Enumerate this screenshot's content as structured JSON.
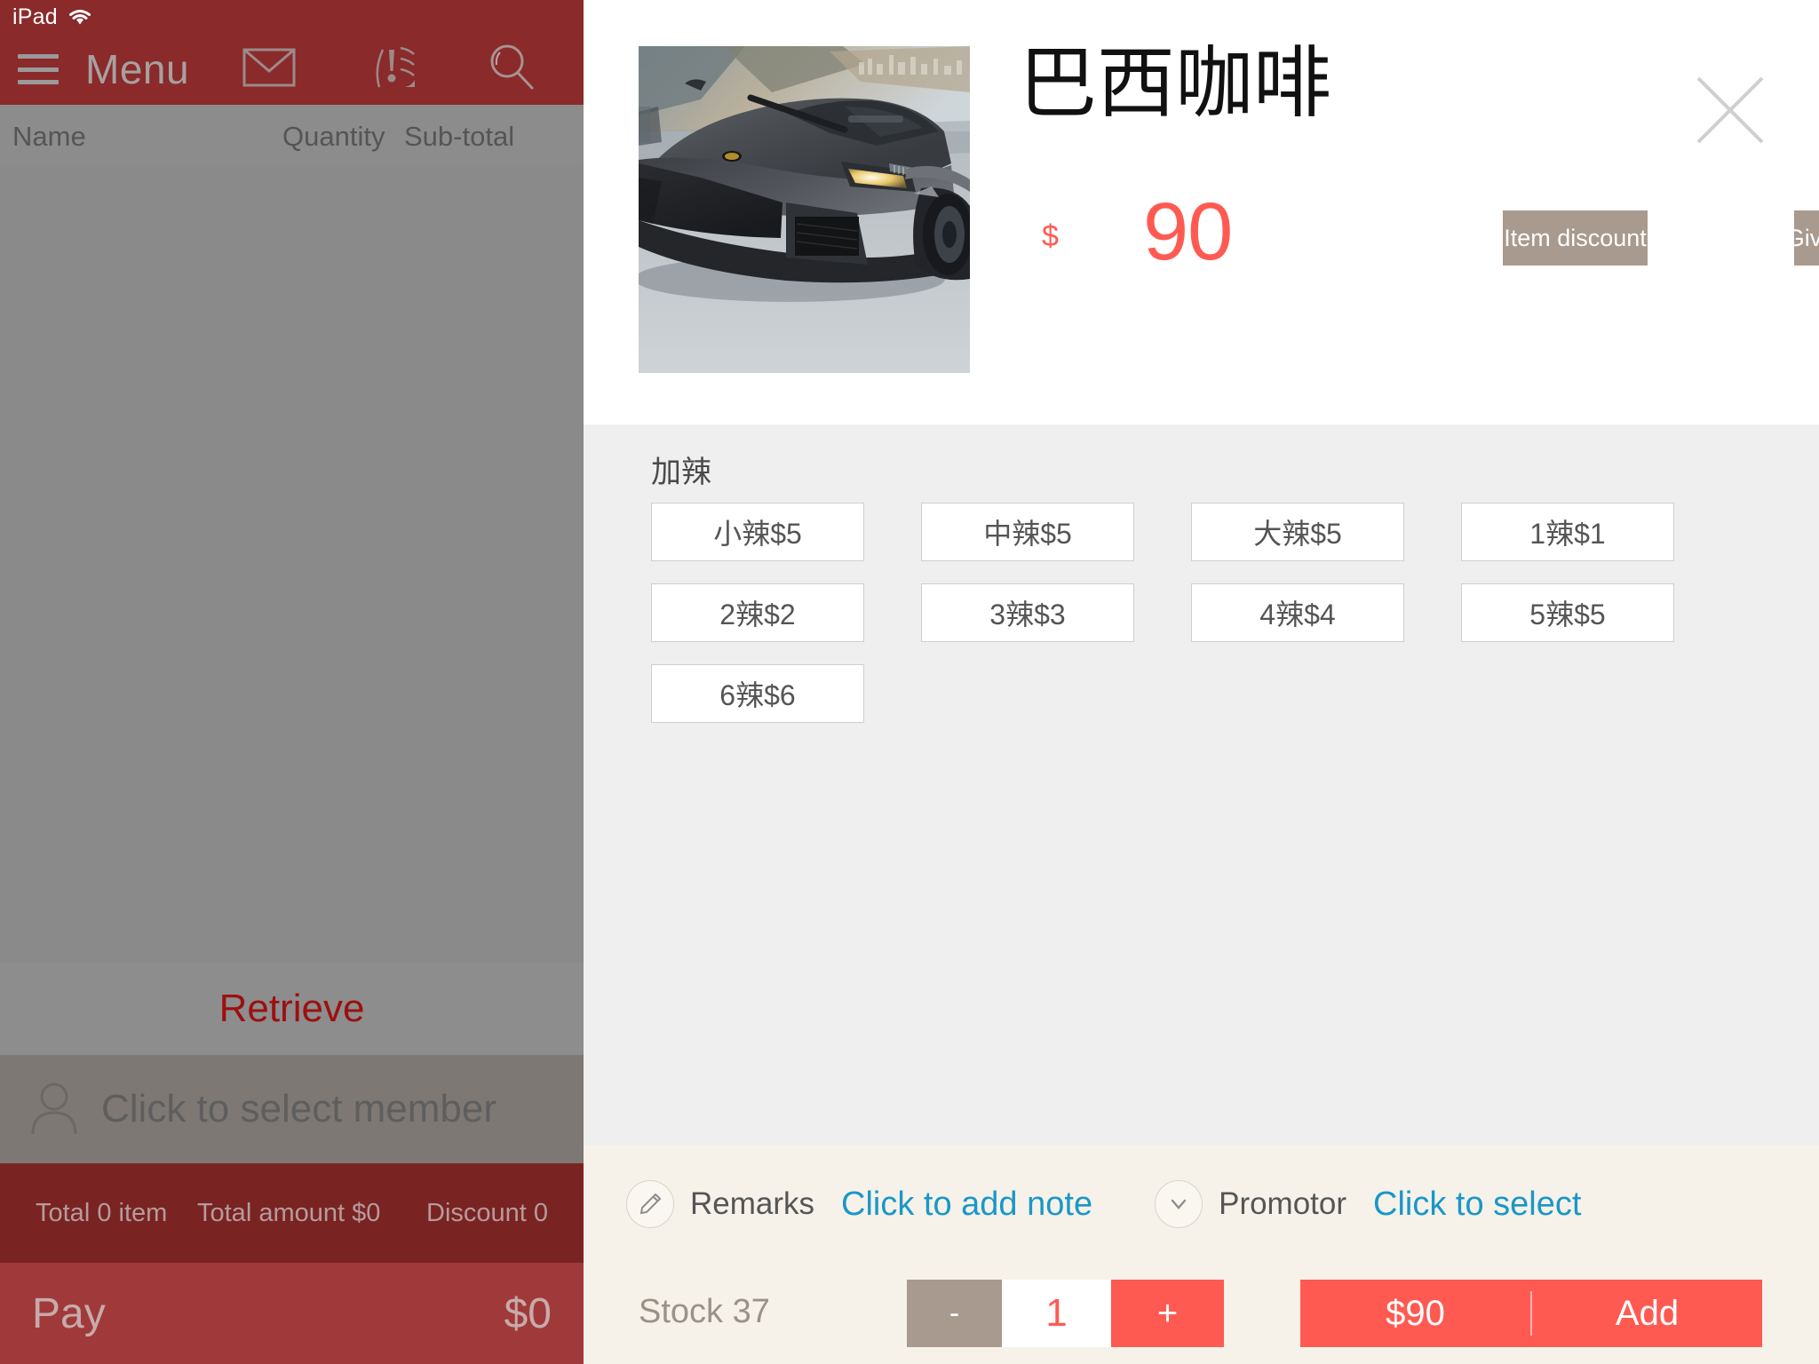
{
  "status_bar": {
    "device_label": "iPad",
    "wifi_icon": "wifi-icon"
  },
  "sidebar": {
    "nav": {
      "menu_icon": "hamburger-menu-icon",
      "title": "Menu",
      "icons": [
        {
          "name": "mail-envelope-icon"
        },
        {
          "name": "alert-notification-icon"
        },
        {
          "name": "search-icon"
        }
      ]
    },
    "cart_columns": {
      "name": "Name",
      "quantity": "Quantity",
      "subtotal": "Sub-total"
    },
    "cart_rows": [],
    "retrieve_label": "Retrieve",
    "member": {
      "icon": "person-avatar-icon",
      "placeholder": "Click to select member"
    },
    "totals": {
      "total_items": "Total 0 item",
      "total_amount": "Total amount $0",
      "discount": "Discount 0"
    },
    "pay": {
      "label": "Pay",
      "amount": "$0"
    }
  },
  "detail": {
    "product_image_name": "product-photo-sports-car",
    "title": "巴西咖啡",
    "currency_symbol": "$",
    "price": "90",
    "item_discount_label": "Item discount",
    "giveaway_label": "Giveaway",
    "close_icon": "close-x-icon",
    "option_groups": [
      {
        "title": "加辣",
        "options": [
          {
            "label": "小辣$5"
          },
          {
            "label": "中辣$5"
          },
          {
            "label": "大辣$5"
          },
          {
            "label": "1辣$1"
          },
          {
            "label": "2辣$2"
          },
          {
            "label": "3辣$3"
          },
          {
            "label": "4辣$4"
          },
          {
            "label": "5辣$5"
          },
          {
            "label": "6辣$6"
          }
        ]
      }
    ],
    "remarks": {
      "icon": "pencil-edit-icon",
      "label": "Remarks",
      "link": "Click to add note"
    },
    "promotor": {
      "icon": "chevron-down-icon",
      "label": "Promotor",
      "link": "Click to select"
    },
    "action_bar": {
      "stock_label": "Stock 37",
      "minus_label": "-",
      "quantity": "1",
      "plus_label": "+",
      "add_price": "$90",
      "add_label": "Add"
    }
  },
  "colors": {
    "brand_red": "#8a2a2a",
    "pay_red": "#a03a3a",
    "accent_coral": "#ff5a52",
    "taupe": "#a89a8e",
    "link_blue": "#1a97c8",
    "options_bg": "#efefef",
    "cream_bg": "#f6f2e9"
  }
}
